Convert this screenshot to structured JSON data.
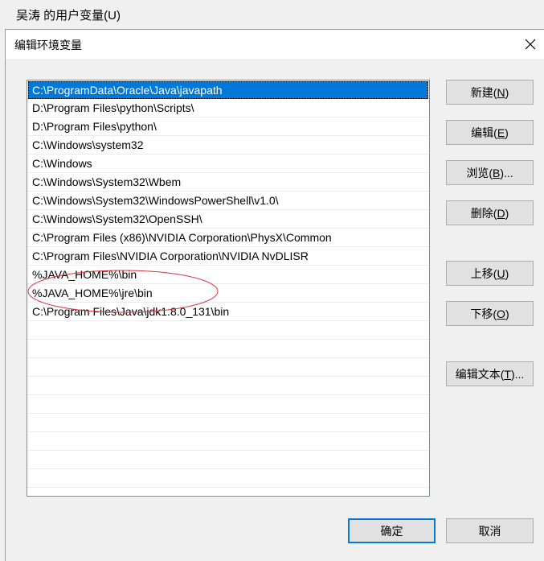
{
  "background": {
    "title": "吴涛 的用户变量(U)"
  },
  "dialog": {
    "title": "编辑环境变量",
    "close_icon": "close-icon"
  },
  "paths": [
    "C:\\ProgramData\\Oracle\\Java\\javapath",
    "D:\\Program Files\\python\\Scripts\\",
    "D:\\Program Files\\python\\",
    "C:\\Windows\\system32",
    "C:\\Windows",
    "C:\\Windows\\System32\\Wbem",
    "C:\\Windows\\System32\\WindowsPowerShell\\v1.0\\",
    "C:\\Windows\\System32\\OpenSSH\\",
    "C:\\Program Files (x86)\\NVIDIA Corporation\\PhysX\\Common",
    "C:\\Program Files\\NVIDIA Corporation\\NVIDIA NvDLISR",
    "%JAVA_HOME%\\bin",
    "%JAVA_HOME%\\jre\\bin",
    "C:\\Program Files\\Java\\jdk1.8.0_131\\bin"
  ],
  "buttons": {
    "new": {
      "label": "新建",
      "key": "N"
    },
    "edit": {
      "label": "编辑",
      "key": "E"
    },
    "browse": {
      "label": "浏览",
      "key": "B",
      "suffix": "..."
    },
    "delete": {
      "label": "删除",
      "key": "D"
    },
    "move_up": {
      "label": "上移",
      "key": "U"
    },
    "move_down": {
      "label": "下移",
      "key": "O"
    },
    "edit_text": {
      "label": "编辑文本",
      "key": "T",
      "suffix": "..."
    },
    "ok": {
      "label": "确定"
    },
    "cancel": {
      "label": "取消"
    }
  },
  "colors": {
    "selection": "#0078d7",
    "annotation": "#d9363e"
  }
}
